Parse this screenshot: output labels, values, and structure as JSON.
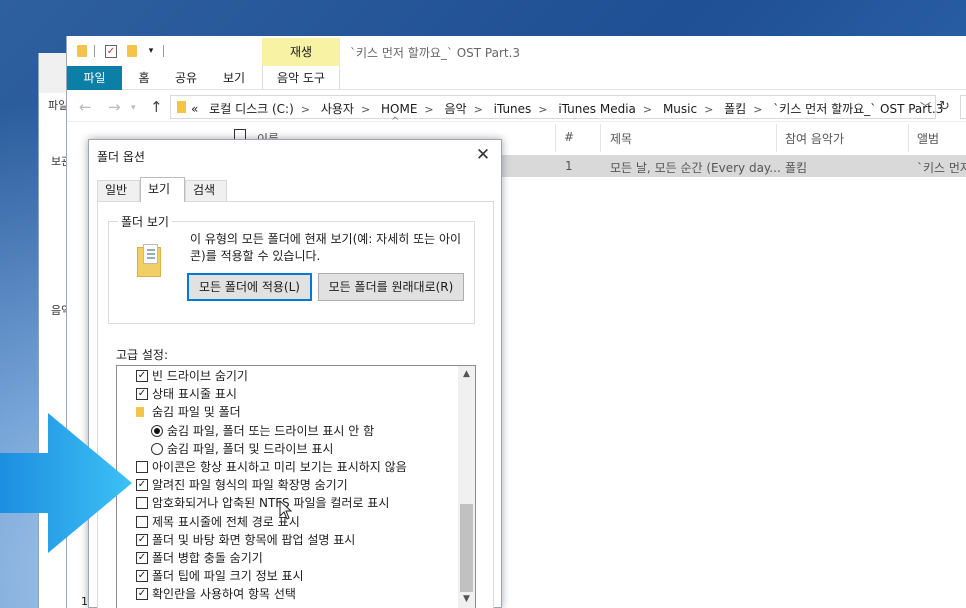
{
  "colors": {
    "accent": "#0c7fa6",
    "context_tab": "#f7f2a4",
    "selected_row": "#d9d9d9",
    "arrow": "#2ba8ee"
  },
  "background_window": {
    "labels": [
      "파일",
      "보관",
      "음악"
    ]
  },
  "explorer": {
    "context_tab": "재생",
    "window_title": "`키스 먼저 할까요_` OST Part.3",
    "ribbon_tabs": [
      "파일",
      "홈",
      "공유",
      "보기",
      "음악 도구"
    ],
    "breadcrumb": [
      "«",
      "로컬 디스크 (C:)",
      "사용자",
      "HOME",
      "음악",
      "iTunes",
      "iTunes Media",
      "Music",
      "폴킴",
      "`키스 먼저 할까요_` OST Part.3"
    ],
    "columns": {
      "name": "이름",
      "number": "#",
      "title": "제목",
      "artist": "참여 음악가",
      "album": "앨범"
    },
    "rows": [
      {
        "number": "1",
        "title": "모든 날, 모든 순간 (Every day...",
        "artist": "폴킴",
        "album": "`키스 먼저"
      }
    ],
    "left_stub_number": "1"
  },
  "dialog": {
    "title": "폴더 옵션",
    "tabs": [
      "일반",
      "보기",
      "검색"
    ],
    "active_tab": "보기",
    "folder_view": {
      "label": "폴더 보기",
      "description": "이 유형의 모든 폴더에 현재 보기(예: 자세히 또는 아이콘)를 적용할 수 있습니다.",
      "apply_button": "모든 폴더에 적용(L)",
      "reset_button": "모든 폴더를 원래대로(R)"
    },
    "advanced_label": "고급 설정:",
    "advanced_items": [
      {
        "kind": "checkbox",
        "checked": true,
        "indent": 1,
        "label": "빈 드라이브 숨기기"
      },
      {
        "kind": "checkbox",
        "checked": true,
        "indent": 1,
        "label": "상태 표시줄 표시"
      },
      {
        "kind": "folder",
        "checked": false,
        "indent": 1,
        "label": "숨김 파일 및 폴더"
      },
      {
        "kind": "radio",
        "checked": true,
        "indent": 2,
        "label": "숨김 파일, 폴더 또는 드라이브 표시 안 함"
      },
      {
        "kind": "radio",
        "checked": false,
        "indent": 2,
        "label": "숨김 파일, 폴더 및 드라이브 표시"
      },
      {
        "kind": "checkbox",
        "checked": false,
        "indent": 1,
        "label": "아이콘은 항상 표시하고 미리 보기는 표시하지 않음"
      },
      {
        "kind": "checkbox",
        "checked": true,
        "indent": 1,
        "label": "알려진 파일 형식의 파일 확장명 숨기기"
      },
      {
        "kind": "checkbox",
        "checked": false,
        "indent": 1,
        "label": "암호화되거나 압축된 NTFS 파일을 컬러로 표시"
      },
      {
        "kind": "checkbox",
        "checked": false,
        "indent": 1,
        "label": "제목 표시줄에 전체 경로 표시"
      },
      {
        "kind": "checkbox",
        "checked": true,
        "indent": 1,
        "label": "폴더 및 바탕 화면 항목에 팝업 설명 표시"
      },
      {
        "kind": "checkbox",
        "checked": true,
        "indent": 1,
        "label": "폴더 병합 충돌 숨기기"
      },
      {
        "kind": "checkbox",
        "checked": true,
        "indent": 1,
        "label": "폴더 팁에 파일 크기 정보 표시"
      },
      {
        "kind": "checkbox",
        "checked": true,
        "indent": 1,
        "label": "확인란을 사용하여 항목 선택"
      }
    ]
  }
}
